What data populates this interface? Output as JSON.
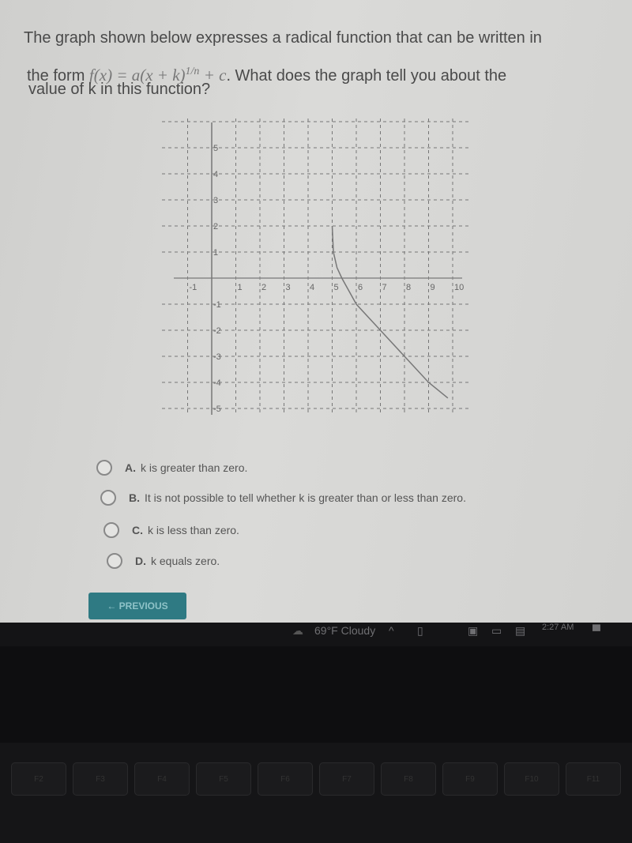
{
  "question": {
    "line1": "The graph shown below expresses a radical function that can be written in",
    "line2_prefix": "the form",
    "formula_main": "f(x) = a(x + k)",
    "formula_exp": "1/n",
    "formula_tail": "+ c",
    "line2_suffix": ". What does the graph tell you about the",
    "line3": "value of k in this function?"
  },
  "graph": {
    "x_ticks": [
      "-1",
      "1",
      "2",
      "3",
      "4",
      "5",
      "6",
      "7",
      "8",
      "9",
      "10"
    ],
    "y_ticks": [
      "5",
      "4",
      "3",
      "2",
      "1",
      "-1",
      "-2",
      "-3",
      "-4",
      "-5"
    ],
    "xlim": [
      -1.5,
      10.5
    ],
    "ylim": [
      -5.5,
      5.5
    ],
    "grid": "dashed",
    "curve": [
      [
        5,
        2
      ],
      [
        5.05,
        1
      ],
      [
        5.2,
        0.4
      ],
      [
        5.4,
        0
      ],
      [
        6,
        -1
      ],
      [
        7,
        -2
      ],
      [
        8,
        -3
      ],
      [
        9,
        -4
      ],
      [
        9.8,
        -4.6
      ]
    ]
  },
  "options": [
    {
      "letter": "A.",
      "text": "k is greater than zero."
    },
    {
      "letter": "B.",
      "text": "It is not possible to tell whether k is greater than or less than zero."
    },
    {
      "letter": "C.",
      "text": "k is less than zero."
    },
    {
      "letter": "D.",
      "text": "k equals zero."
    }
  ],
  "nav": {
    "previous": "← PREVIOUS"
  },
  "taskbar": {
    "weather": "69°F Cloudy",
    "time": "2:27 AM"
  },
  "keyboard": {
    "keys": [
      "F2",
      "F3",
      "F4",
      "F5",
      "F6",
      "F7",
      "F8",
      "F9",
      "F10",
      "F11"
    ]
  }
}
